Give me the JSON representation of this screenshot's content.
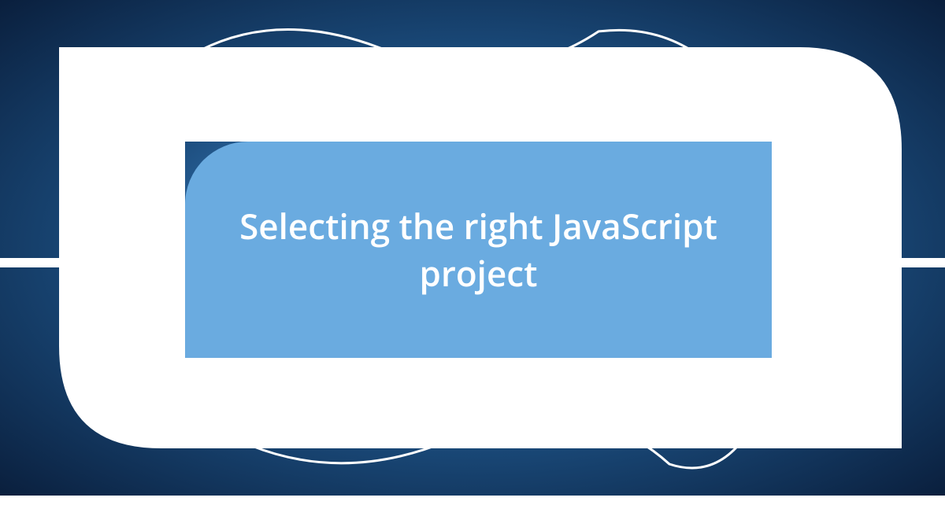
{
  "title": "Selecting the right JavaScript project",
  "colors": {
    "background_dark": "#0a1f3d",
    "background_light": "#5a9fd4",
    "panel": "#6aabe0",
    "frame": "#ffffff",
    "text": "#ffffff"
  }
}
